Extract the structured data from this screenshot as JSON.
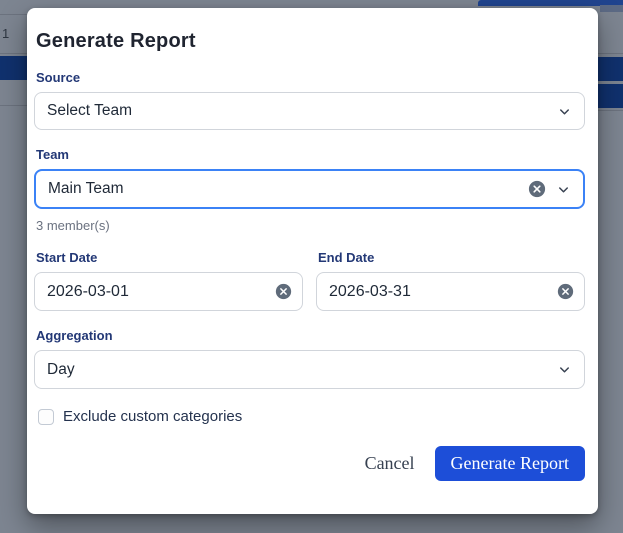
{
  "background": {
    "page_number": "1"
  },
  "modal": {
    "title": "Generate Report",
    "fields": {
      "source": {
        "label": "Source",
        "value": "Select Team"
      },
      "team": {
        "label": "Team",
        "value": "Main Team",
        "helper": "3 member(s)"
      },
      "start_date": {
        "label": "Start Date",
        "value": "2026-03-01"
      },
      "end_date": {
        "label": "End Date",
        "value": "2026-03-31"
      },
      "aggregation": {
        "label": "Aggregation",
        "value": "Day"
      },
      "exclude_custom_categories": {
        "label": "Exclude custom categories",
        "checked": false
      }
    },
    "buttons": {
      "cancel": "Cancel",
      "submit": "Generate Report"
    }
  },
  "icons": {
    "dropdown": "chevron-down",
    "clear": "circle-x"
  },
  "colors": {
    "primary_button": "#1d4ed8",
    "focus_border": "#3b82f6",
    "label_text": "#233876",
    "overlay": "#7d8591",
    "background_navy_bar": "#10316e",
    "clear_icon": "#5f6b7a"
  }
}
